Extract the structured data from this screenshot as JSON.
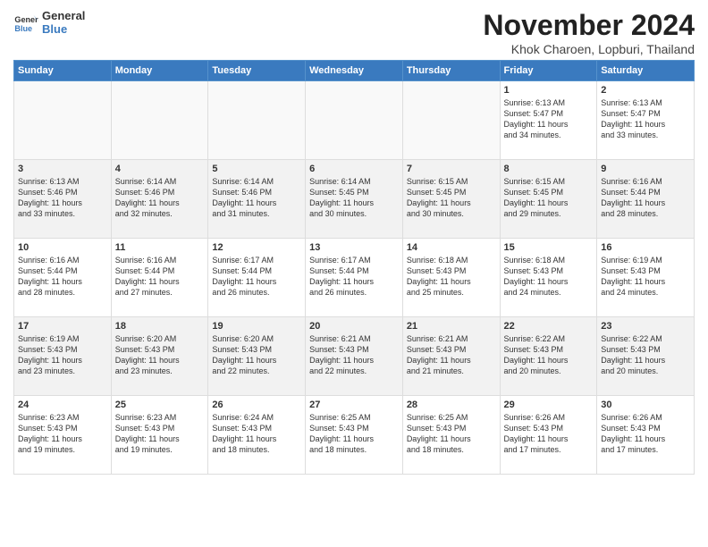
{
  "header": {
    "logo_line1": "General",
    "logo_line2": "Blue",
    "month": "November 2024",
    "location": "Khok Charoen, Lopburi, Thailand"
  },
  "days_of_week": [
    "Sunday",
    "Monday",
    "Tuesday",
    "Wednesday",
    "Thursday",
    "Friday",
    "Saturday"
  ],
  "weeks": [
    [
      {
        "day": "",
        "info": ""
      },
      {
        "day": "",
        "info": ""
      },
      {
        "day": "",
        "info": ""
      },
      {
        "day": "",
        "info": ""
      },
      {
        "day": "",
        "info": ""
      },
      {
        "day": "1",
        "info": "Sunrise: 6:13 AM\nSunset: 5:47 PM\nDaylight: 11 hours\nand 34 minutes."
      },
      {
        "day": "2",
        "info": "Sunrise: 6:13 AM\nSunset: 5:47 PM\nDaylight: 11 hours\nand 33 minutes."
      }
    ],
    [
      {
        "day": "3",
        "info": "Sunrise: 6:13 AM\nSunset: 5:46 PM\nDaylight: 11 hours\nand 33 minutes."
      },
      {
        "day": "4",
        "info": "Sunrise: 6:14 AM\nSunset: 5:46 PM\nDaylight: 11 hours\nand 32 minutes."
      },
      {
        "day": "5",
        "info": "Sunrise: 6:14 AM\nSunset: 5:46 PM\nDaylight: 11 hours\nand 31 minutes."
      },
      {
        "day": "6",
        "info": "Sunrise: 6:14 AM\nSunset: 5:45 PM\nDaylight: 11 hours\nand 30 minutes."
      },
      {
        "day": "7",
        "info": "Sunrise: 6:15 AM\nSunset: 5:45 PM\nDaylight: 11 hours\nand 30 minutes."
      },
      {
        "day": "8",
        "info": "Sunrise: 6:15 AM\nSunset: 5:45 PM\nDaylight: 11 hours\nand 29 minutes."
      },
      {
        "day": "9",
        "info": "Sunrise: 6:16 AM\nSunset: 5:44 PM\nDaylight: 11 hours\nand 28 minutes."
      }
    ],
    [
      {
        "day": "10",
        "info": "Sunrise: 6:16 AM\nSunset: 5:44 PM\nDaylight: 11 hours\nand 28 minutes."
      },
      {
        "day": "11",
        "info": "Sunrise: 6:16 AM\nSunset: 5:44 PM\nDaylight: 11 hours\nand 27 minutes."
      },
      {
        "day": "12",
        "info": "Sunrise: 6:17 AM\nSunset: 5:44 PM\nDaylight: 11 hours\nand 26 minutes."
      },
      {
        "day": "13",
        "info": "Sunrise: 6:17 AM\nSunset: 5:44 PM\nDaylight: 11 hours\nand 26 minutes."
      },
      {
        "day": "14",
        "info": "Sunrise: 6:18 AM\nSunset: 5:43 PM\nDaylight: 11 hours\nand 25 minutes."
      },
      {
        "day": "15",
        "info": "Sunrise: 6:18 AM\nSunset: 5:43 PM\nDaylight: 11 hours\nand 24 minutes."
      },
      {
        "day": "16",
        "info": "Sunrise: 6:19 AM\nSunset: 5:43 PM\nDaylight: 11 hours\nand 24 minutes."
      }
    ],
    [
      {
        "day": "17",
        "info": "Sunrise: 6:19 AM\nSunset: 5:43 PM\nDaylight: 11 hours\nand 23 minutes."
      },
      {
        "day": "18",
        "info": "Sunrise: 6:20 AM\nSunset: 5:43 PM\nDaylight: 11 hours\nand 23 minutes."
      },
      {
        "day": "19",
        "info": "Sunrise: 6:20 AM\nSunset: 5:43 PM\nDaylight: 11 hours\nand 22 minutes."
      },
      {
        "day": "20",
        "info": "Sunrise: 6:21 AM\nSunset: 5:43 PM\nDaylight: 11 hours\nand 22 minutes."
      },
      {
        "day": "21",
        "info": "Sunrise: 6:21 AM\nSunset: 5:43 PM\nDaylight: 11 hours\nand 21 minutes."
      },
      {
        "day": "22",
        "info": "Sunrise: 6:22 AM\nSunset: 5:43 PM\nDaylight: 11 hours\nand 20 minutes."
      },
      {
        "day": "23",
        "info": "Sunrise: 6:22 AM\nSunset: 5:43 PM\nDaylight: 11 hours\nand 20 minutes."
      }
    ],
    [
      {
        "day": "24",
        "info": "Sunrise: 6:23 AM\nSunset: 5:43 PM\nDaylight: 11 hours\nand 19 minutes."
      },
      {
        "day": "25",
        "info": "Sunrise: 6:23 AM\nSunset: 5:43 PM\nDaylight: 11 hours\nand 19 minutes."
      },
      {
        "day": "26",
        "info": "Sunrise: 6:24 AM\nSunset: 5:43 PM\nDaylight: 11 hours\nand 18 minutes."
      },
      {
        "day": "27",
        "info": "Sunrise: 6:25 AM\nSunset: 5:43 PM\nDaylight: 11 hours\nand 18 minutes."
      },
      {
        "day": "28",
        "info": "Sunrise: 6:25 AM\nSunset: 5:43 PM\nDaylight: 11 hours\nand 18 minutes."
      },
      {
        "day": "29",
        "info": "Sunrise: 6:26 AM\nSunset: 5:43 PM\nDaylight: 11 hours\nand 17 minutes."
      },
      {
        "day": "30",
        "info": "Sunrise: 6:26 AM\nSunset: 5:43 PM\nDaylight: 11 hours\nand 17 minutes."
      }
    ]
  ]
}
